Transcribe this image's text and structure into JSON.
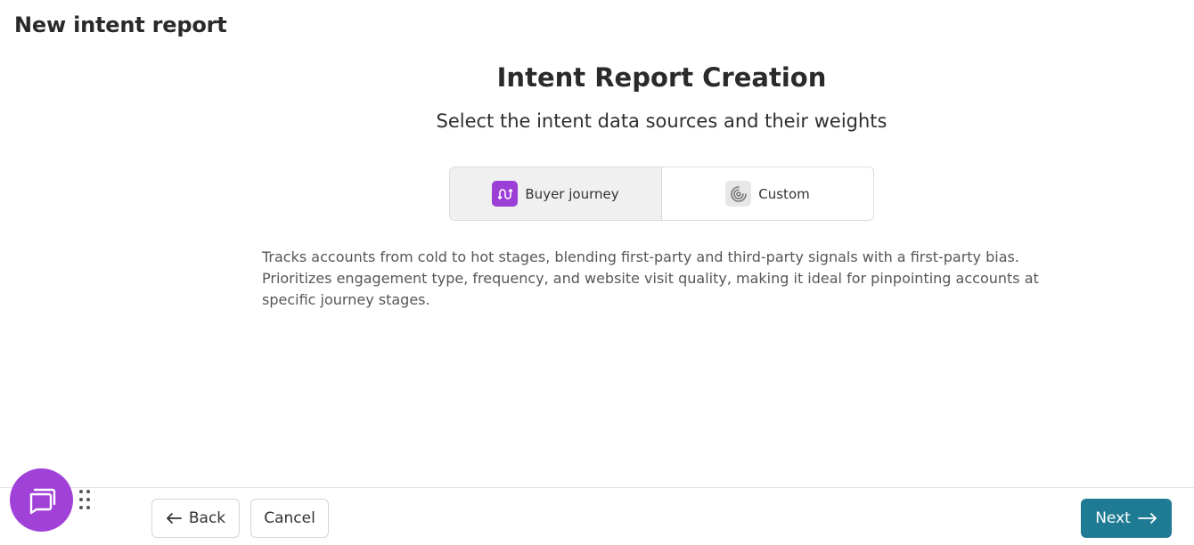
{
  "page": {
    "title": "New intent report"
  },
  "main": {
    "heading": "Intent Report Creation",
    "subheading": "Select the intent data sources and their weights",
    "description": "Tracks accounts from cold to hot stages, blending first-party and third-party signals with a first-party bias. Prioritizes engagement type, frequency, and website visit quality, making it ideal for pinpointing accounts at specific journey stages."
  },
  "toggle": {
    "options": [
      {
        "label": "Buyer journey",
        "icon": "buyer-journey-icon",
        "selected": true
      },
      {
        "label": "Custom",
        "icon": "target-icon",
        "selected": false
      }
    ]
  },
  "footer": {
    "back_label": "Back",
    "cancel_label": "Cancel",
    "next_label": "Next"
  },
  "colors": {
    "accent_purple": "#9b3fd6",
    "primary_teal": "#1f7b93"
  }
}
